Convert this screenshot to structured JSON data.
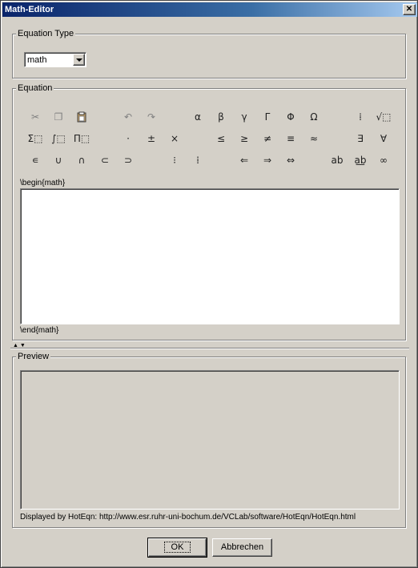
{
  "window": {
    "title": "Math-Editor",
    "close_label": "✕"
  },
  "equation_type": {
    "legend": "Equation Type",
    "selected": "math"
  },
  "equation": {
    "legend": "Equation",
    "toolbar_row1": [
      {
        "name": "cut-icon",
        "glyph": "✂"
      },
      {
        "name": "copy-icon",
        "glyph": "❐"
      },
      {
        "name": "paste-icon",
        "glyph": "📋"
      },
      {
        "name": "undo-icon",
        "glyph": "↶"
      },
      {
        "name": "redo-icon",
        "glyph": "↷"
      },
      {
        "name": "alpha",
        "glyph": "α"
      },
      {
        "name": "beta",
        "glyph": "β"
      },
      {
        "name": "gamma",
        "glyph": "γ"
      },
      {
        "name": "Gamma",
        "glyph": "Γ"
      },
      {
        "name": "Phi",
        "glyph": "Φ"
      },
      {
        "name": "Omega",
        "glyph": "Ω"
      },
      {
        "name": "fraction-icon",
        "glyph": "⁞"
      },
      {
        "name": "sqrt-icon",
        "glyph": "√⬚"
      }
    ],
    "toolbar_row2": [
      {
        "name": "sum-icon",
        "glyph": "Σ⬚"
      },
      {
        "name": "integral-icon",
        "glyph": "∫⬚"
      },
      {
        "name": "product-icon",
        "glyph": "Π⬚"
      },
      {
        "name": "cdot",
        "glyph": "·"
      },
      {
        "name": "plus-minus",
        "glyph": "±"
      },
      {
        "name": "times",
        "glyph": "×"
      },
      {
        "name": "leq",
        "glyph": "≤"
      },
      {
        "name": "geq",
        "glyph": "≥"
      },
      {
        "name": "neq",
        "glyph": "≠"
      },
      {
        "name": "equiv",
        "glyph": "≡"
      },
      {
        "name": "approx",
        "glyph": "≈"
      },
      {
        "name": "exists",
        "glyph": "∃"
      },
      {
        "name": "forall",
        "glyph": "∀"
      }
    ],
    "toolbar_row3": [
      {
        "name": "in",
        "glyph": "∊"
      },
      {
        "name": "cup",
        "glyph": "∪"
      },
      {
        "name": "cap",
        "glyph": "∩"
      },
      {
        "name": "subset",
        "glyph": "⊂"
      },
      {
        "name": "supset",
        "glyph": "⊃"
      },
      {
        "name": "superscript-icon",
        "glyph": "⁝"
      },
      {
        "name": "subscript-icon",
        "glyph": "⁞"
      },
      {
        "name": "leftarrow",
        "glyph": "⇐"
      },
      {
        "name": "rightarrow",
        "glyph": "⇒"
      },
      {
        "name": "leftrightarrow",
        "glyph": "⇔"
      },
      {
        "name": "ab-icon",
        "glyph": "ab"
      },
      {
        "name": "ab-sub-icon",
        "glyph": "a͟b"
      },
      {
        "name": "infinity",
        "glyph": "∞"
      }
    ],
    "begin_label": "\\begin{math}",
    "end_label": "\\end{math}",
    "content": ""
  },
  "preview": {
    "legend": "Preview",
    "displayed_by": "Displayed by HotEqn: http://www.esr.ruhr-uni-bochum.de/VCLab/software/HotEqn/HotEqn.html"
  },
  "buttons": {
    "ok": "OK",
    "cancel": "Abbrechen"
  }
}
